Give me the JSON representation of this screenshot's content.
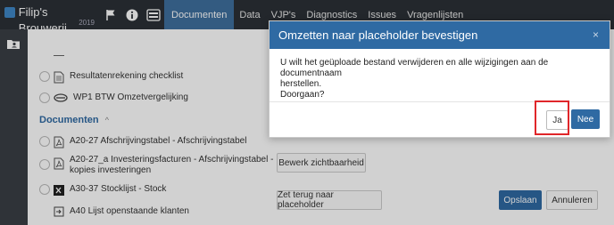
{
  "app": {
    "title": "Filip's Brouwerij",
    "year": "2019"
  },
  "nav": {
    "tabs": [
      {
        "label": "Documenten",
        "active": true
      },
      {
        "label": "Data"
      },
      {
        "label": "VJP's"
      },
      {
        "label": "Diagnostics"
      },
      {
        "label": "Issues"
      },
      {
        "label": "Vragenlijsten"
      }
    ]
  },
  "list": {
    "items_top": [
      {
        "label": "Resultatenrekening checklist"
      },
      {
        "label": "WP1 BTW Omzetvergelijking"
      }
    ],
    "section_title": "Documenten",
    "documents": [
      {
        "label": "A20-27 Afschrijvingstabel - Afschrijvingstabel"
      },
      {
        "line1": "A20-27_a Investeringsfacturen - Afschrijvingstabel -",
        "line2": "kopies investeringen"
      },
      {
        "label": "A30-37 Stocklijst - Stock"
      },
      {
        "label": "A40 Lijst openstaande klanten"
      }
    ]
  },
  "actions": {
    "visibility": "Bewerk zichtbaarheid",
    "reset_placeholder": "Zet terug naar placeholder",
    "save": "Opslaan",
    "cancel": "Annuleren"
  },
  "modal": {
    "title": "Omzetten naar placeholder bevestigen",
    "close": "×",
    "line1": "U wilt het geüploade bestand verwijderen en alle wijzigingen aan de documentnaam",
    "line2": "herstellen.",
    "line3": "Doorgaan?",
    "yes": "Ja",
    "no": "Nee"
  },
  "colors": {
    "accent": "#2f6aa3",
    "nav_bg": "#2b3036",
    "highlight": "#e0262a"
  }
}
